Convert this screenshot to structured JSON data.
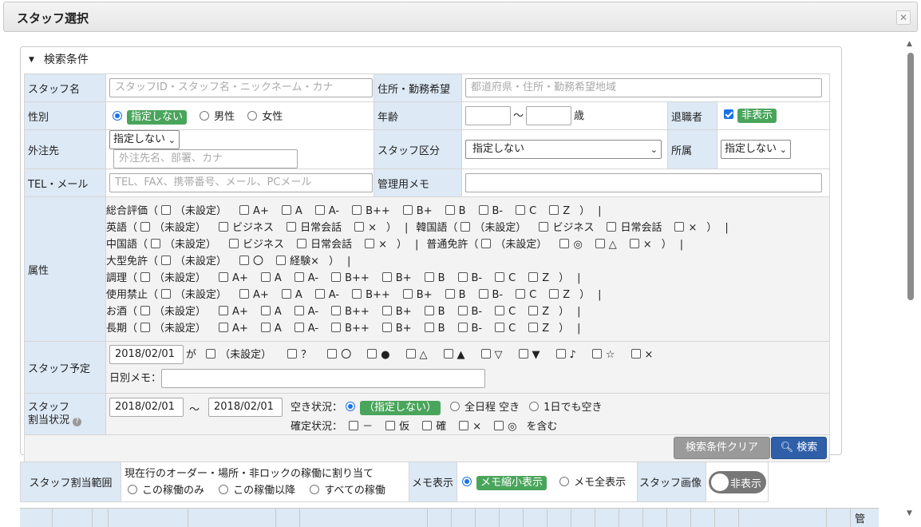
{
  "window": {
    "title": "スタッフ選択",
    "close_icon": "close-icon"
  },
  "panel": {
    "heading": "検索条件"
  },
  "row1": {
    "staff_name_label": "スタッフ名",
    "staff_name_placeholder": "スタッフID・スタッフ名・ニックネーム・カナ",
    "address_label": "住所・勤務希望",
    "address_placeholder": "都道府県・住所・勤務希望地域"
  },
  "row2": {
    "gender_label": "性別",
    "gender_options": [
      "指定しない",
      "男性",
      "女性"
    ],
    "gender_selected": "指定しない",
    "age_label": "年齢",
    "age_from": "",
    "age_sep": "～",
    "age_unit": "歳",
    "retired_label": "退職者",
    "retired_value": "非表示",
    "retired_checked": true
  },
  "row3": {
    "client_label": "外注先",
    "client_select": "指定しない",
    "client_placeholder": "外注先名、部署、カナ",
    "staff_type_label": "スタッフ区分",
    "staff_type_select": "指定しない",
    "affiliation_label": "所属",
    "affiliation_select": "指定しない"
  },
  "row4": {
    "contact_label": "TEL・メール",
    "contact_placeholder": "TEL、FAX、携帯番号、メール、PCメール",
    "memo_label": "管理用メモ",
    "memo_value": ""
  },
  "attributes": {
    "label": "属性",
    "lines": [
      [
        {
          "name": "総合評価",
          "options": [
            "（未設定）",
            "A+",
            "A",
            "A-",
            "B++",
            "B+",
            "B",
            "B-",
            "C",
            "Z"
          ]
        }
      ],
      [
        {
          "name": "英語",
          "options": [
            "（未設定）",
            "ビジネス",
            "日常会話",
            "×"
          ]
        },
        {
          "name": "韓国語",
          "options": [
            "（未設定）",
            "ビジネス",
            "日常会話",
            "×"
          ]
        }
      ],
      [
        {
          "name": "中国語",
          "options": [
            "（未設定）",
            "ビジネス",
            "日常会話",
            "×"
          ]
        },
        {
          "name": "普通免許",
          "options": [
            "（未設定）",
            "◎",
            "△",
            "×"
          ]
        }
      ],
      [
        {
          "name": "大型免許",
          "options": [
            "（未設定）",
            "〇",
            "経験×"
          ]
        }
      ],
      [
        {
          "name": "調理",
          "options": [
            "（未設定）",
            "A+",
            "A",
            "A-",
            "B++",
            "B+",
            "B",
            "B-",
            "C",
            "Z"
          ]
        }
      ],
      [
        {
          "name": "使用禁止",
          "options": [
            "（未設定）",
            "A+",
            "A",
            "A-",
            "B++",
            "B+",
            "B",
            "B-",
            "C",
            "Z"
          ]
        }
      ],
      [
        {
          "name": "お酒",
          "options": [
            "（未設定）",
            "A+",
            "A",
            "A-",
            "B++",
            "B+",
            "B",
            "B-",
            "C",
            "Z"
          ]
        }
      ],
      [
        {
          "name": "長期",
          "options": [
            "（未設定）",
            "A+",
            "A",
            "A-",
            "B++",
            "B+",
            "B",
            "B-",
            "C",
            "Z"
          ]
        }
      ]
    ]
  },
  "schedule": {
    "label": "スタッフ予定",
    "date": "2018/02/01",
    "ga": "が",
    "options": [
      "（未設定）",
      "？",
      "〇",
      "●",
      "△",
      "▲",
      "▽",
      "▼",
      "♪",
      "☆",
      "×"
    ],
    "daily_memo_label": "日別メモ：",
    "daily_memo_value": ""
  },
  "assignment": {
    "label_line1": "スタッフ",
    "label_line2": "割当状況",
    "help_icon": "help-icon",
    "date_from": "2018/02/01",
    "date_sep": "～",
    "date_to": "2018/02/01",
    "vacancy_label": "空き状況：",
    "vacancy_options": [
      "（指定しない）",
      "全日程 空き",
      "1日でも空き"
    ],
    "vacancy_selected": "（指定しない）",
    "confirm_label": "確定状況：",
    "confirm_options": [
      "－",
      "仮",
      "確",
      "×",
      "◎"
    ],
    "confirm_suffix": "を含む"
  },
  "buttons": {
    "clear": "検索条件クリア",
    "search": "検索",
    "search_icon": "search-icon"
  },
  "bottom": {
    "range_label": "スタッフ割当範囲",
    "range_caption": "現在行のオーダー・場所・非ロックの稼働に割り当て",
    "range_options": [
      "この稼働のみ",
      "この稼働以降",
      "すべての稼働"
    ],
    "memo_label": "メモ表示",
    "memo_options": [
      "メモ縮小表示",
      "メモ全表示"
    ],
    "memo_selected": "メモ縮小表示",
    "image_label": "スタッフ画像",
    "image_toggle": "非表示"
  },
  "grid_header_partial": "管"
}
